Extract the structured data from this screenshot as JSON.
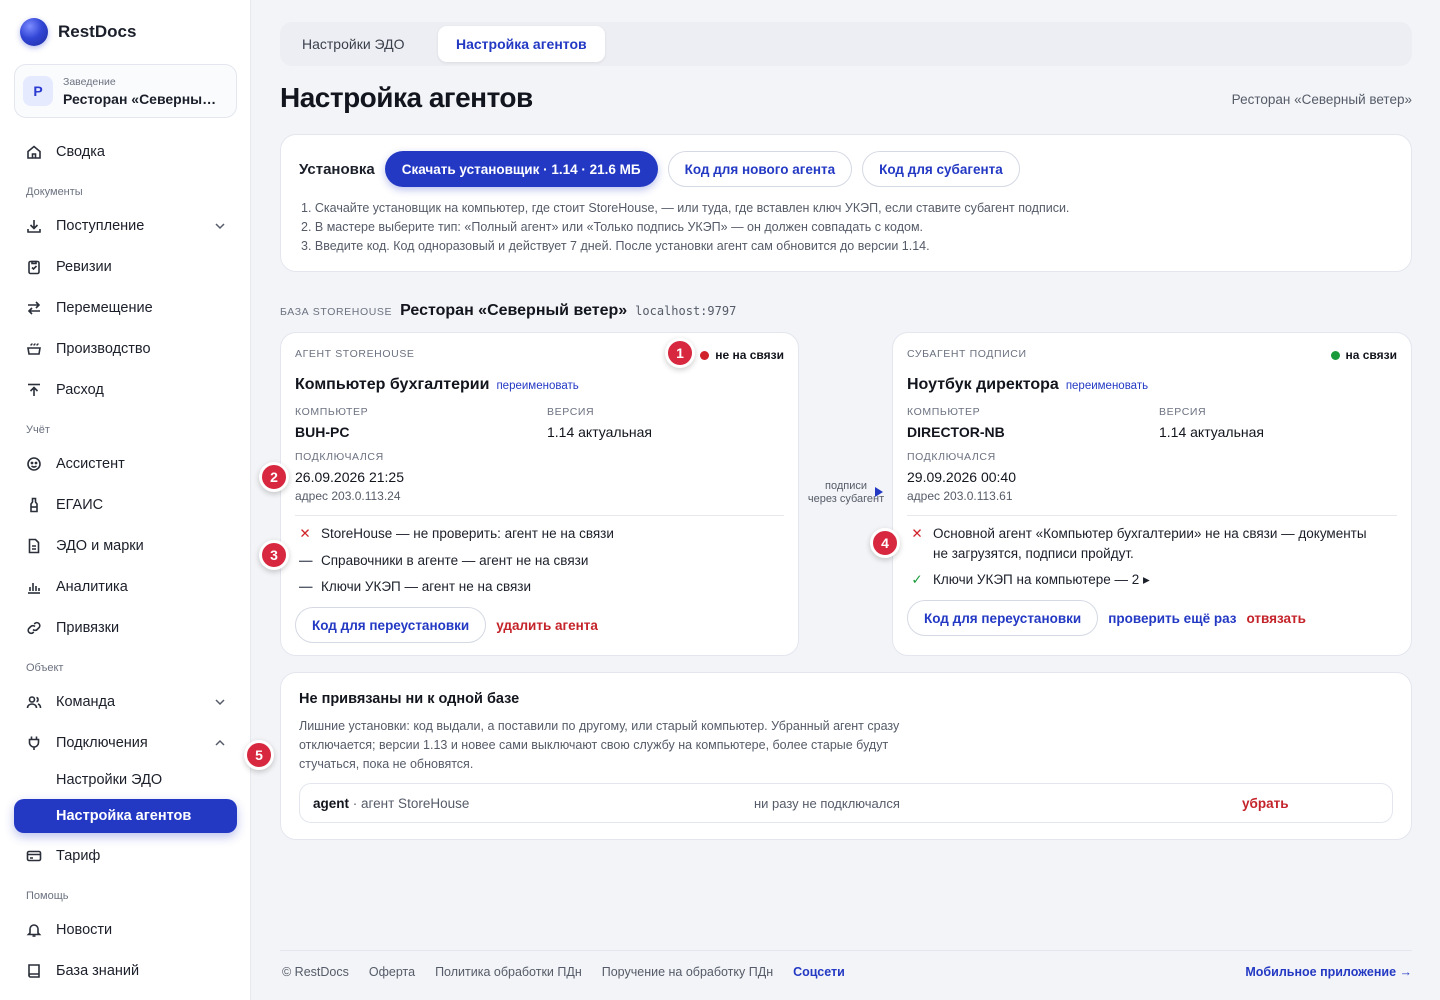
{
  "app": {
    "name": "RestDocs"
  },
  "venue": {
    "label": "Заведение",
    "name": "Ресторан «Северный ...",
    "avatar": "Р"
  },
  "sidebar": {
    "summary": "Сводка",
    "sections": {
      "documents": "Документы",
      "accounting": "Учёт",
      "object": "Объект",
      "help": "Помощь"
    },
    "items": {
      "incoming": "Поступление",
      "revisions": "Ревизии",
      "transfer": "Перемещение",
      "production": "Производство",
      "expense": "Расход",
      "assistant": "Ассистент",
      "egais": "ЕГАИС",
      "edo": "ЭДО и марки",
      "analytics": "Аналитика",
      "bindings": "Привязки",
      "team": "Команда",
      "connections": "Подключения",
      "edo_settings": "Настройки ЭДО",
      "agents_settings": "Настройка агентов",
      "tariff": "Тариф",
      "news": "Новости",
      "kb": "База знаний"
    }
  },
  "tabs": [
    "Настройки ЭДО",
    "Настройка агентов"
  ],
  "page": {
    "title": "Настройка агентов",
    "restaurant": "Ресторан «Северный ветер»"
  },
  "install": {
    "label": "Установка",
    "download": "Скачать установщик · 1.14 · 21.6 МБ",
    "new_agent_code": "Код для нового агента",
    "subagent_code": "Код для субагента",
    "steps": [
      "1. Скачайте установщик на компьютер, где стоит StoreHouse, — или туда, где вставлен ключ УКЭП, если ставите субагент подписи.",
      "2. В мастере выберите тип: «Полный агент» или «Только подпись УКЭП» — он должен совпадать с кодом.",
      "3. Введите код. Код одноразовый и действует 7 дней. После установки агент сам обновится до версии 1.14."
    ]
  },
  "db": {
    "label": "БАЗА STOREHOUSE",
    "name": "Ресторан «Северный ветер»",
    "host": "localhost:9797"
  },
  "agent_left": {
    "type": "АГЕНТ STOREHOUSE",
    "status": "не на связи",
    "status_color": "#d0232a",
    "title": "Компьютер бухгалтерии",
    "rename": "переименовать",
    "computer_lbl": "КОМПЬЮТЕР",
    "computer": "BUH-PC",
    "version_lbl": "ВЕРСИЯ",
    "version": "1.14 актуальная",
    "connected_lbl": "ПОДКЛЮЧАЛСЯ",
    "connected": "26.09.2026 21:25",
    "address": "адрес 203.0.113.24",
    "checks": [
      "StoreHouse — не проверить: агент не на связи",
      "Справочники в агенте — агент не на связи",
      "Ключи УКЭП — агент не на связи"
    ],
    "reinstall": "Код для переустановки",
    "delete": "удалить агента"
  },
  "middle": {
    "line1": "подписи",
    "line2": "через субагент"
  },
  "agent_right": {
    "type": "СУБАГЕНТ ПОДПИСИ",
    "status": "на связи",
    "status_color": "#1a9a3b",
    "title": "Ноутбук директора",
    "rename": "переименовать",
    "computer_lbl": "КОМПЬЮТЕР",
    "computer": "DIRECTOR-NB",
    "version_lbl": "ВЕРСИЯ",
    "version": "1.14 актуальная",
    "connected_lbl": "ПОДКЛЮЧАЛСЯ",
    "connected": "29.09.2026 00:40",
    "address": "адрес 203.0.113.61",
    "check_fail_1": "Основной агент «Компьютер бухгалтерии» не на связи — документы",
    "check_fail_2": "не загрузятся, подписи пройдут.",
    "check_ok": "Ключи УКЭП на компьютере — 2 ▸",
    "reinstall": "Код для переустановки",
    "recheck": "проверить ещё раз",
    "unbind": "отвязать"
  },
  "badges": [
    "1",
    "2",
    "3",
    "4",
    "5"
  ],
  "unbound": {
    "title": "Не привязаны ни к одной базе",
    "desc": [
      "Лишние установки: код выдали, а поставили по другому, или старый компьютер. Убранный агент сразу",
      "отключается; версии 1.13 и новее сами выключают свою службу на компьютере, более старые будут",
      "стучаться, пока не обновятся."
    ],
    "row": {
      "name": "agent",
      "type": "· агент StoreHouse",
      "status": "ни разу не подключался",
      "remove": "убрать"
    }
  },
  "footer": {
    "copyright": "© RestDocs",
    "offer": "Оферта",
    "privacy": "Политика обработки ПДн",
    "assignment": "Поручение на обработку ПДн",
    "social": "Соцсети",
    "mobile": "Мобильное приложение →"
  }
}
